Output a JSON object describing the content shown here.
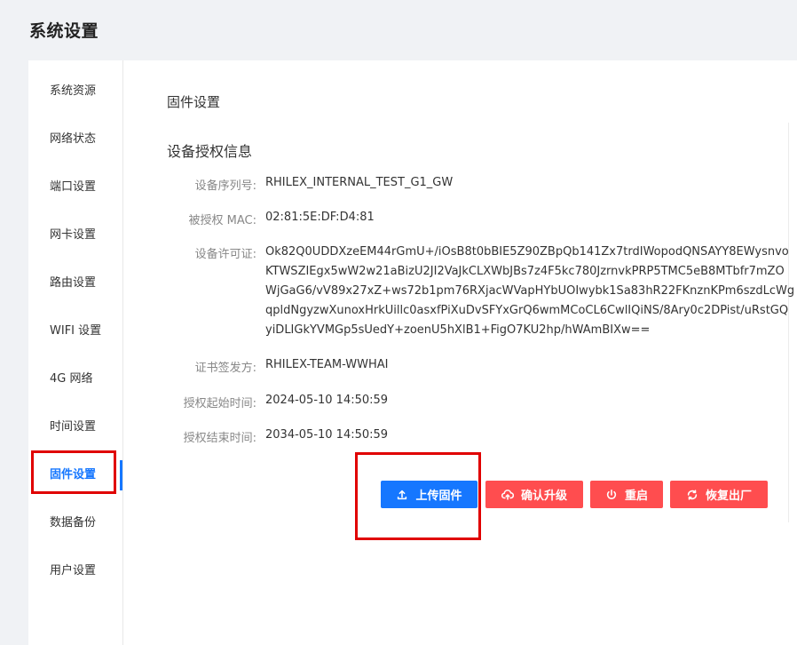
{
  "page_title": "系统设置",
  "sidebar": {
    "items": [
      {
        "label": "系统资源"
      },
      {
        "label": "网络状态"
      },
      {
        "label": "端口设置"
      },
      {
        "label": "网卡设置"
      },
      {
        "label": "路由设置"
      },
      {
        "label": "WIFI 设置"
      },
      {
        "label": "4G 网络"
      },
      {
        "label": "时间设置"
      },
      {
        "label": "固件设置",
        "active": true
      },
      {
        "label": "数据备份"
      },
      {
        "label": "用户设置"
      }
    ]
  },
  "main": {
    "section_title": "固件设置",
    "sub_title": "设备授权信息",
    "fields": [
      {
        "label": "设备序列号:",
        "value": "RHILEX_INTERNAL_TEST_G1_GW"
      },
      {
        "label": "被授权 MAC:",
        "value": "02:81:5E:DF:D4:81"
      },
      {
        "label": "设备许可证:",
        "value": "Ok82Q0UDDXzeEM44rGmU+/iOsB8t0bBIE5Z90ZBpQb141Zx7trdIWopodQNSAYY8EWysnvoKTWSZIEgx5wW2w21aBizU2JI2VaJkCLXWbJBs7z4F5kc780JzrnvkPRP5TMC5eB8MTbfr7mZOWjGaG6/vV89x27xZ+ws72b1pm76RXjacWVapHYbUOIwybk1Sa83hR22FKnznKPm6szdLcWgqpldNgyzwXunoxHrkUillc0asxfPiXuDvSFYxGrQ6wmMCoCL6CwlIQiNS/8Ary0c2DPist/uRstGQyiDLIGkYVMGp5sUedY+zoenU5hXlB1+FigO7KU2hp/hWAmBIXw=="
      },
      {
        "label": "证书签发方:",
        "value": "RHILEX-TEAM-WWHAI"
      },
      {
        "label": "授权起始时间:",
        "value": "2024-05-10 14:50:59"
      },
      {
        "label": "授权结束时间:",
        "value": "2034-05-10 14:50:59"
      }
    ],
    "license_lines": [
      "Ok82Q0UDDXzeEM44rGmU+/iOsB8t0bBIE5Z90ZBpQb141Zx7trdIWopodQNSAYY8EWysnvo",
      "KTWSZIEgx5wW2w21aBizU2JI2VaJkCLXWbJBs7z4F5kc780JzrnvkPRP5TMC5eB8MTbfr7mZO",
      "WjGaG6/vV89x27xZ+ws72b1pm76RXjacWVapHYbUOIwybk1Sa83hR22FKnznKPm6szdLcWg",
      "qpldNgyzwXunoxHrkUillc0asxfPiXuDvSFYxGrQ6wmMCoCL6CwlIQiNS/8Ary0c2DPist/uRstGQ",
      "yiDLIGkYVMGp5sUedY+zoenU5hXlB1+FigO7KU2hp/hWAmBIXw=="
    ]
  },
  "buttons": {
    "upload": "上传固件",
    "confirm_upgrade": "确认升级",
    "reboot": "重启",
    "factory_reset": "恢复出厂"
  },
  "colors": {
    "primary": "#1677ff",
    "danger": "#ff4d4f",
    "annotation": "#e00000"
  }
}
